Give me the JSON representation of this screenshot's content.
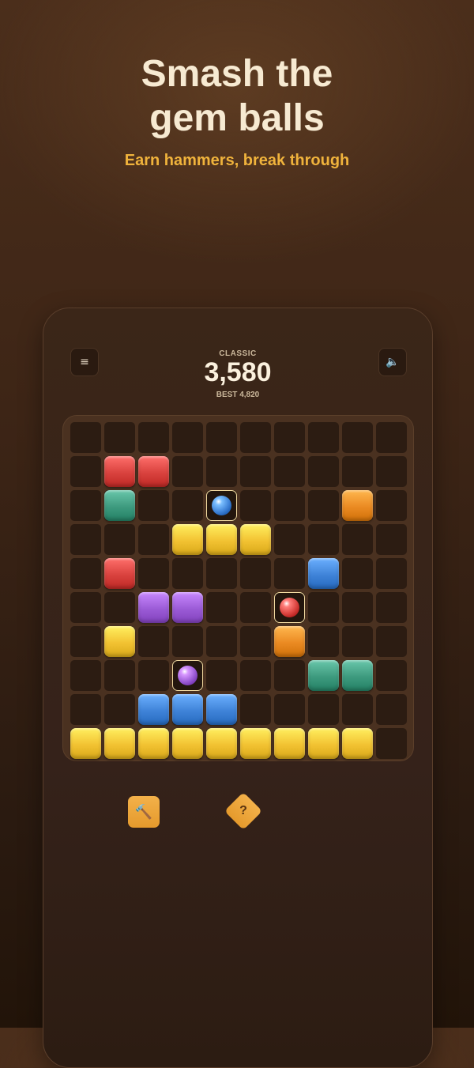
{
  "promo": {
    "headline_line1": "Smash the",
    "headline_line2": "gem balls",
    "subhead": "Earn hammers, break through"
  },
  "game": {
    "mode": "CLASSIC",
    "score": "3,580",
    "best": "BEST 4,820",
    "menu_icon": "≡",
    "sound_icon": "🔈"
  },
  "colors": {
    "red": "#d9423e",
    "teal": "#3d9a7e",
    "gold": "#f2c232",
    "blue": "#3f83d8",
    "purple": "#9b5bd6",
    "orange": "#ea8a22",
    "accent": "#f0b33c"
  },
  "board": {
    "rows": 10,
    "cols": 10,
    "tiles": [
      {
        "row": 1,
        "col": 1,
        "color": "red"
      },
      {
        "row": 1,
        "col": 2,
        "color": "red"
      },
      {
        "row": 2,
        "col": 1,
        "color": "teal"
      },
      {
        "row": 2,
        "col": 4,
        "color": "blue",
        "gem": true
      },
      {
        "row": 2,
        "col": 8,
        "color": "orange"
      },
      {
        "row": 3,
        "col": 3,
        "color": "gold"
      },
      {
        "row": 3,
        "col": 4,
        "color": "gold"
      },
      {
        "row": 3,
        "col": 5,
        "color": "gold"
      },
      {
        "row": 4,
        "col": 1,
        "color": "red"
      },
      {
        "row": 4,
        "col": 7,
        "color": "blue"
      },
      {
        "row": 5,
        "col": 2,
        "color": "purple"
      },
      {
        "row": 5,
        "col": 3,
        "color": "purple"
      },
      {
        "row": 5,
        "col": 6,
        "color": "red",
        "gem": true
      },
      {
        "row": 6,
        "col": 1,
        "color": "gold"
      },
      {
        "row": 6,
        "col": 6,
        "color": "orange"
      },
      {
        "row": 7,
        "col": 3,
        "color": "purple",
        "gem": true
      },
      {
        "row": 7,
        "col": 7,
        "color": "teal"
      },
      {
        "row": 7,
        "col": 8,
        "color": "teal"
      },
      {
        "row": 8,
        "col": 2,
        "color": "blue"
      },
      {
        "row": 8,
        "col": 3,
        "color": "blue"
      },
      {
        "row": 8,
        "col": 4,
        "color": "blue"
      },
      {
        "row": 9,
        "col": 0,
        "color": "gold"
      },
      {
        "row": 9,
        "col": 1,
        "color": "gold"
      },
      {
        "row": 9,
        "col": 2,
        "color": "gold"
      },
      {
        "row": 9,
        "col": 3,
        "color": "gold"
      },
      {
        "row": 9,
        "col": 4,
        "color": "gold"
      },
      {
        "row": 9,
        "col": 5,
        "color": "gold"
      },
      {
        "row": 9,
        "col": 6,
        "color": "gold"
      },
      {
        "row": 9,
        "col": 7,
        "color": "gold"
      },
      {
        "row": 9,
        "col": 8,
        "color": "gold"
      }
    ]
  },
  "tools": {
    "hammer_icon": "🔨",
    "hint_label": "?"
  }
}
